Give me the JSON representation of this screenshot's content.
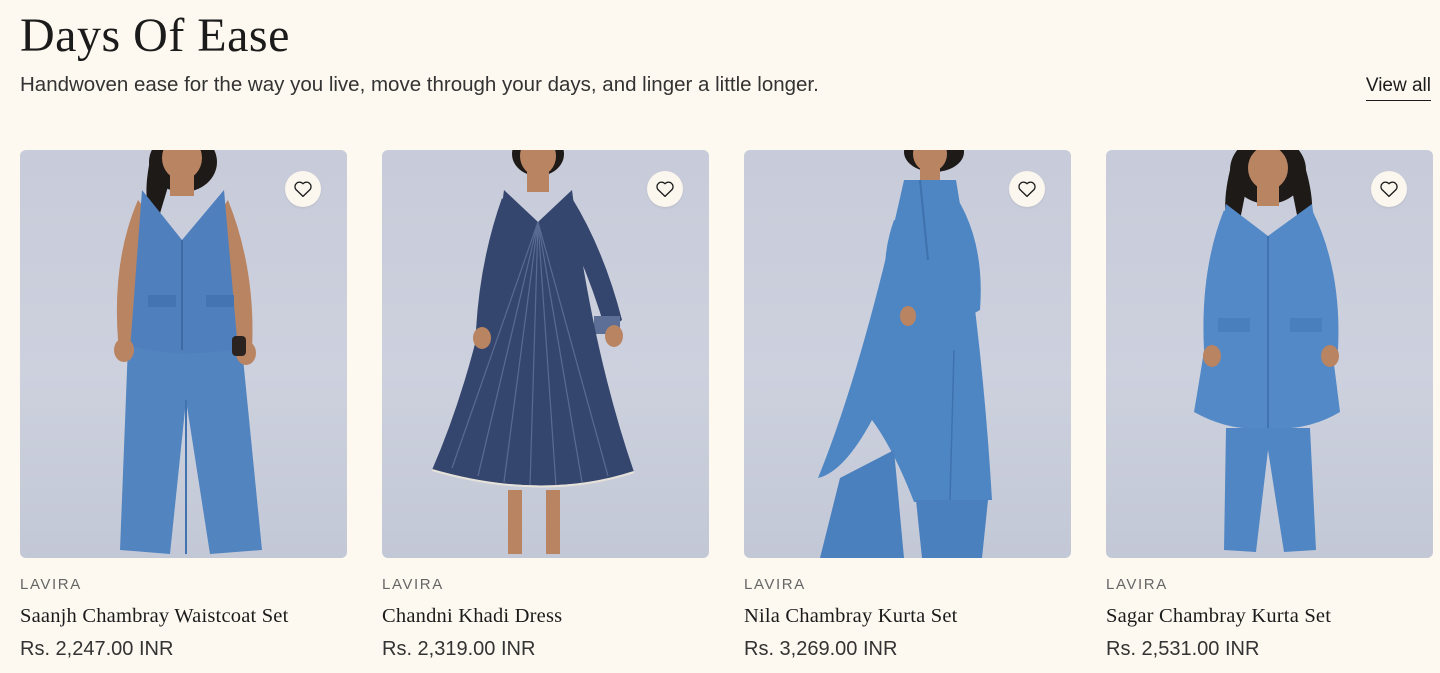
{
  "section": {
    "title": "Days Of Ease",
    "subtitle": "Handwoven ease for the way you live, move through your days, and linger a little longer.",
    "view_all_label": "View all"
  },
  "products": [
    {
      "brand": "LAVIRA",
      "name": "Saanjh Chambray Waistcoat Set",
      "price": "Rs. 2,247.00 INR",
      "outfit_color": "#4f7fbd",
      "icon": "heart-outline-icon"
    },
    {
      "brand": "LAVIRA",
      "name": "Chandni Khadi Dress",
      "price": "Rs. 2,319.00 INR",
      "outfit_color": "#35466e",
      "icon": "heart-outline-icon"
    },
    {
      "brand": "LAVIRA",
      "name": "Nila Chambray Kurta Set",
      "price": "Rs. 3,269.00 INR",
      "outfit_color": "#4e86c4",
      "icon": "heart-outline-icon"
    },
    {
      "brand": "LAVIRA",
      "name": "Sagar Chambray Kurta Set",
      "price": "Rs. 2,531.00 INR",
      "outfit_color": "#5289c6",
      "icon": "heart-outline-icon"
    }
  ],
  "colors": {
    "background": "#fdf9f0",
    "photo_backdrop": "#c8ccda",
    "skin": "#b98462",
    "hair": "#1e1a18"
  }
}
